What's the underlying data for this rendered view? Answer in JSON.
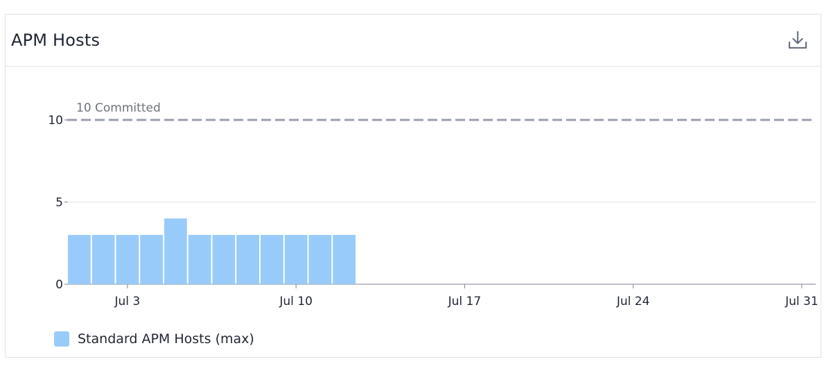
{
  "panel": {
    "title": "APM Hosts",
    "download_icon": "download-icon"
  },
  "colors": {
    "bar": "#99cbfa",
    "commit_line": "#9a9fad",
    "grid": "#e3e5ea",
    "axis": "#7d8290"
  },
  "chart_data": {
    "type": "bar",
    "x": [
      "Jul 1",
      "Jul 2",
      "Jul 3",
      "Jul 4",
      "Jul 5",
      "Jul 6",
      "Jul 7",
      "Jul 8",
      "Jul 9",
      "Jul 10",
      "Jul 11",
      "Jul 12"
    ],
    "series": [
      {
        "name": "Standard APM Hosts (max)",
        "values": [
          3,
          3,
          3,
          3,
          4,
          3,
          3,
          3,
          3,
          3,
          3,
          3
        ]
      }
    ],
    "xlim": [
      "Jul 1",
      "Jul 31"
    ],
    "x_ticks": [
      "Jul 3",
      "Jul 10",
      "Jul 17",
      "Jul 24",
      "Jul 31"
    ],
    "y_ticks": [
      0,
      5,
      10
    ],
    "ylim": [
      0,
      10
    ],
    "threshold": {
      "value": 10,
      "label": "10 Committed"
    },
    "grid": true,
    "legend": "bottom-left"
  }
}
